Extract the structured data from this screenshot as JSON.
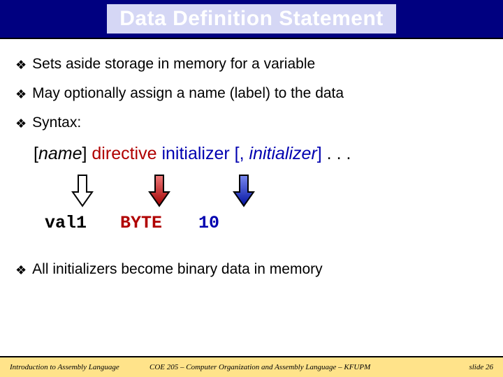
{
  "title": "Data Definition Statement",
  "bullets": {
    "b1": "Sets aside storage in memory for a variable",
    "b2": "May optionally assign a name (label) to the data",
    "b3": "Syntax:",
    "b4": "All initializers become binary data in memory"
  },
  "syntax": {
    "name_open": "[",
    "name_word": "name",
    "name_close": "]",
    "directive": "directive",
    "init1": "initializer",
    "sep_open": " [, ",
    "init2": "initializer",
    "sep_close": "]",
    "dots": " . . ."
  },
  "example": {
    "c1": "val1",
    "c2": "BYTE",
    "c3": "10"
  },
  "footer": {
    "left": "Introduction to Assembly Language",
    "center": "COE 205 – Computer Organization and Assembly Language – KFUPM",
    "right": "slide 26"
  },
  "colors": {
    "title_bg": "#000080",
    "title_fill": "#d5d7f5",
    "directive": "#b00000",
    "initializer": "#0000b0",
    "footer_bg": "#ffe38a"
  }
}
